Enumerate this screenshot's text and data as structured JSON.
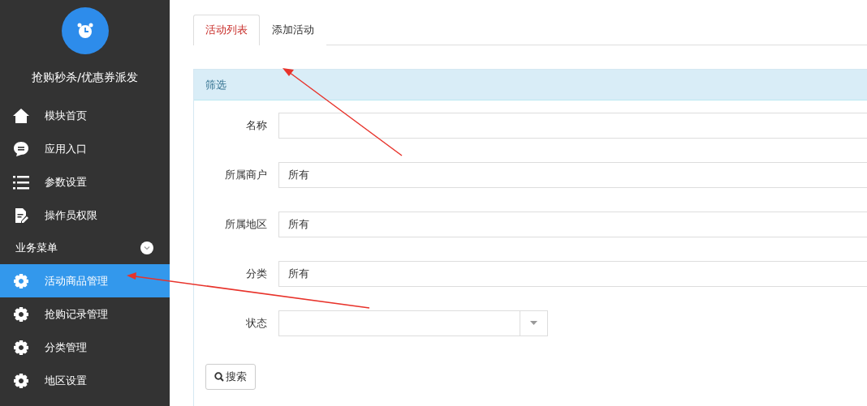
{
  "sidebar": {
    "title": "抢购秒杀/优惠券派发",
    "nav_items": [
      {
        "label": "模块首页",
        "selected": false
      },
      {
        "label": "应用入口",
        "selected": false
      },
      {
        "label": "参数设置",
        "selected": false
      },
      {
        "label": "操作员权限",
        "selected": false
      }
    ],
    "section": {
      "label": "业务菜单",
      "expanded": true,
      "items": [
        {
          "label": "活动商品管理",
          "selected": true
        },
        {
          "label": "抢购记录管理",
          "selected": false
        },
        {
          "label": "分类管理",
          "selected": false
        },
        {
          "label": "地区设置",
          "selected": false
        }
      ]
    }
  },
  "tabs": [
    {
      "label": "活动列表",
      "selected": true
    },
    {
      "label": "添加活动",
      "selected": false
    }
  ],
  "filter_panel": {
    "title": "筛选",
    "fields": [
      {
        "label": "名称",
        "kind": "input"
      },
      {
        "label": "所属商户",
        "kind": "input",
        "value": "所有"
      },
      {
        "label": "所属地区",
        "kind": "input",
        "value": "所有"
      },
      {
        "label": "分类",
        "kind": "input",
        "value": "所有"
      },
      {
        "label": "状态",
        "kind": "select"
      }
    ],
    "search_button": "搜索"
  }
}
